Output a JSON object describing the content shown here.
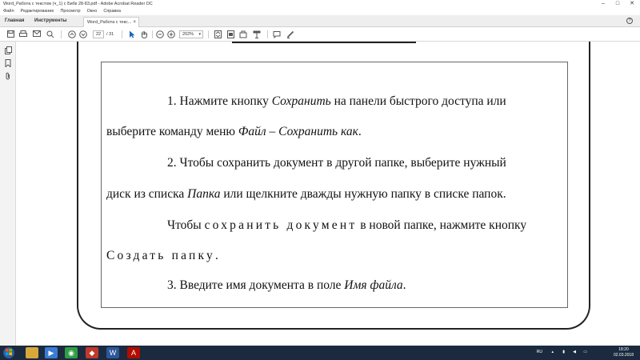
{
  "window": {
    "title": "Word_Работа с текстом (ч_1) с Бибк 28-83.pdf - Adobe Acrobat Reader DC",
    "minimize": "–",
    "maximize": "□",
    "close": "✕"
  },
  "menu": [
    "Файл",
    "Редактирование",
    "Просмотр",
    "Окно",
    "Справка"
  ],
  "tabs": {
    "home": "Главная",
    "tools": "Инструменты",
    "document": "Word_Работа с текс...",
    "document_close": "×",
    "help": "?"
  },
  "toolbar": {
    "page_current": "22",
    "page_total": "/ 31",
    "zoom": "202%"
  },
  "document": {
    "p1_l1_a": "1. Нажмите кнопку ",
    "p1_l1_b": "Сохранить",
    "p1_l1_c": " на панели быстрого доступа или",
    "p1_l2_a": "выберите команду меню ",
    "p1_l2_b": "Файл – Сохранить как",
    "p1_l2_c": ".",
    "p2_l1": "2. Чтобы сохранить документ в другой папке, выберите нужный",
    "p2_l2_a": "диск из списка ",
    "p2_l2_b": "Папка",
    "p2_l2_c": " или щелкните дважды нужную папку в списке папок.",
    "p3_l1_a": "Чтобы ",
    "p3_l1_b": "сохранить документ",
    "p3_l1_c": " в новой папке, нажмите кнопку",
    "p3_l2_a": "Создать папку",
    "p3_l2_b": ".",
    "p4_a": "3. Введите имя документа в поле ",
    "p4_b": "Имя файла",
    "p4_c": "."
  },
  "taskbar": {
    "language": "RU",
    "time": "18:20",
    "date": "02.03.2018"
  }
}
